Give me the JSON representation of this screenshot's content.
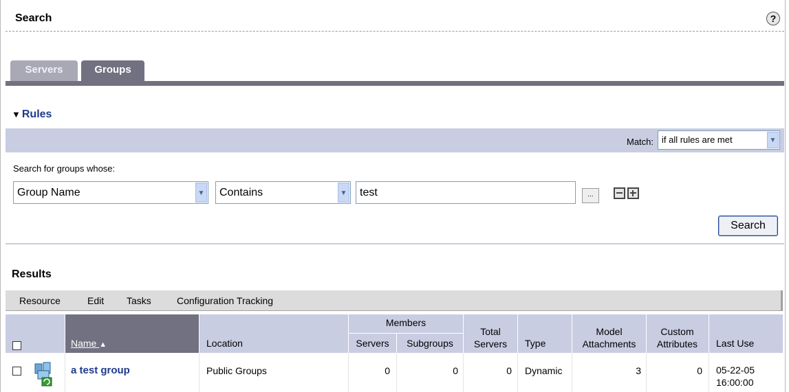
{
  "header": {
    "title": "Search",
    "help_glyph": "?"
  },
  "tabs": [
    {
      "label": "Servers"
    },
    {
      "label": "Groups"
    }
  ],
  "rules": {
    "heading": "Rules",
    "match_label": "Match:",
    "match_value": "if all rules are met",
    "search_for_label": "Search for groups whose:",
    "field_value": "Group Name",
    "operator_value": "Contains",
    "text_value": "test",
    "ellipsis_label": "...",
    "search_button": "Search"
  },
  "results": {
    "heading": "Results",
    "menu": [
      "Resource",
      "Edit",
      "Tasks",
      "Configuration Tracking"
    ],
    "columns": {
      "name": "Name",
      "location": "Location",
      "members": "Members",
      "servers": "Servers",
      "subgroups": "Subgroups",
      "total_servers_1": "Total",
      "total_servers_2": "Servers",
      "type": "Type",
      "model_1": "Model",
      "model_2": "Attachments",
      "custom_1": "Custom",
      "custom_2": "Attributes",
      "last_use": "Last Use",
      "sort_glyph": "▲"
    },
    "rows": [
      {
        "name": "a test group",
        "location": "Public Groups",
        "servers": "0",
        "subgroups": "0",
        "total_servers": "0",
        "type": "Dynamic",
        "model_attachments": "3",
        "custom_attributes": "0",
        "last_use_date": "05-22-05",
        "last_use_time": "16:00:00"
      }
    ]
  },
  "icons": {
    "help": "help-icon",
    "group": "dynamic-group-icon"
  },
  "colors": {
    "accent": "#1e3a8a",
    "tab_active": "#717181",
    "band": "#c8cde2"
  }
}
